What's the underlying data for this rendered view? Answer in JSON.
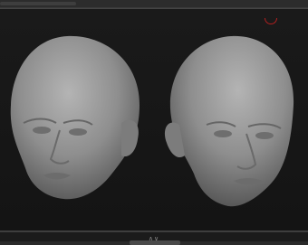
{
  "app": {
    "accent_color": "#b02020",
    "background_color": "#141414",
    "model_color": "#9a9a9a"
  },
  "viewport": {
    "models": [
      {
        "name": "head-front-left-view"
      },
      {
        "name": "head-front-right-view"
      }
    ]
  },
  "bottom_bar": {
    "handle_glyph": "∧∨"
  }
}
